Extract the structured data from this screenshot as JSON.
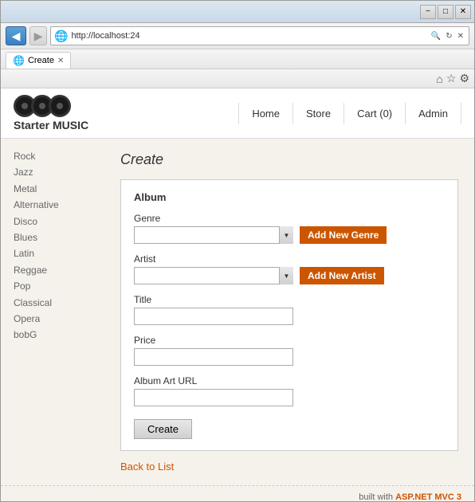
{
  "window": {
    "title_bar_buttons": [
      "−",
      "□",
      "✕"
    ]
  },
  "browser": {
    "address": "http://localhost:24",
    "tab_label": "Create",
    "tab_icon": "🌐"
  },
  "nav": {
    "site_title": "Starter MUSIC",
    "links": [
      "Home",
      "Store",
      "Cart (0)",
      "Admin"
    ]
  },
  "sidebar": {
    "items": [
      "Rock",
      "Jazz",
      "Metal",
      "Alternative",
      "Disco",
      "Blues",
      "Latin",
      "Reggae",
      "Pop",
      "Classical",
      "Opera",
      "bobG"
    ]
  },
  "form": {
    "page_title": "Create",
    "section_title": "Album",
    "genre_label": "Genre",
    "genre_placeholder": "",
    "add_genre_btn": "Add New Genre",
    "artist_label": "Artist",
    "artist_placeholder": "",
    "add_artist_btn": "Add New Artist",
    "title_label": "Title",
    "title_value": "",
    "price_label": "Price",
    "price_value": "",
    "album_art_url_label": "Album Art URL",
    "album_art_url_value": "",
    "create_btn": "Create",
    "back_to_list": "Back to List"
  },
  "footer": {
    "text": "built with ",
    "highlight": "ASP.NET MVC 3"
  },
  "colors": {
    "orange": "#cc5500",
    "link": "#666"
  }
}
